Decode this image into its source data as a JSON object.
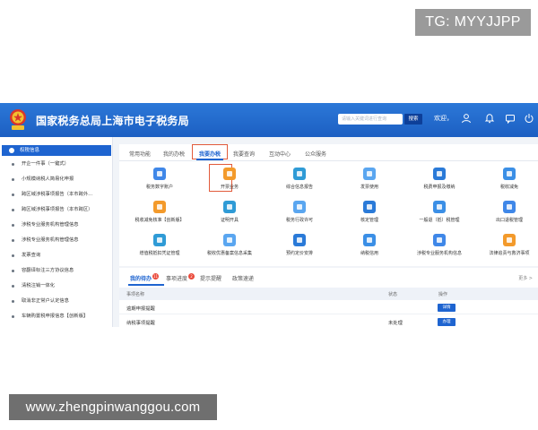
{
  "overlay": {
    "tg_label": "TG: MYYJJPP",
    "url_label": "www.zhengpinwanggou.com"
  },
  "header": {
    "title": "国家税务总局上海市电子税务局",
    "search_placeholder": "请输入关键词进行查询",
    "search_button": "搜索",
    "welcome": "欢迎，"
  },
  "sidebar": {
    "head": "权税信息",
    "items": [
      "开企一件事（一键式）",
      "小规模纳税人简易化申报",
      "跨区域涉税事项报告（本市跨外...",
      "跨区域涉税事项报告（本市跨区）",
      "涉税专业服务机构管理信息",
      "涉税专业服务机构管理信息",
      "发票查询",
      "容翻译标注三方协议信息",
      "清税注销一体化",
      "取消非正常户认定信息",
      "车辆购置税申报信息【创新版】"
    ]
  },
  "tabs": {
    "items": [
      "常用功能",
      "我的办税",
      "我要办税",
      "我要查询",
      "互动中心",
      "公众服务"
    ],
    "active_index": 2
  },
  "functions": {
    "rows": [
      [
        "税务数字账户",
        "开票业务",
        "综合信息报告",
        "发票使用",
        "税费申报及缴纳",
        "税收减免"
      ],
      [
        "税收减免核准【创新版】",
        "证明开具",
        "税务行政许可",
        "核定管理",
        "一般退（抵）税管理",
        "出口退税管理"
      ],
      [
        "增值税抵扣凭证管理",
        "税收优惠备案信息采集",
        "预约定价安排",
        "纳税信用",
        "涉税专业服务机构信息",
        "法律追责与救济事项"
      ]
    ],
    "highlighted": "开票业务",
    "colors": [
      "#3f87e8",
      "#f39a2b",
      "#2f9bd6",
      "#5aa6f0",
      "#2a7ad8",
      "#3b8fe6"
    ]
  },
  "todo": {
    "tabs": [
      {
        "label": "我的待办",
        "badge": "11"
      },
      {
        "label": "事项进度",
        "badge": "2"
      },
      {
        "label": "提示提醒",
        "badge": ""
      },
      {
        "label": "政策速递",
        "badge": ""
      }
    ],
    "more": "更多 >",
    "columns": [
      "事项名称",
      "状态",
      "操作"
    ],
    "rows": [
      {
        "name": "逾期申报提醒",
        "status": "",
        "action": "详情"
      },
      {
        "name": "纳税事项提醒",
        "status": "未处理",
        "action": "办理"
      }
    ]
  }
}
